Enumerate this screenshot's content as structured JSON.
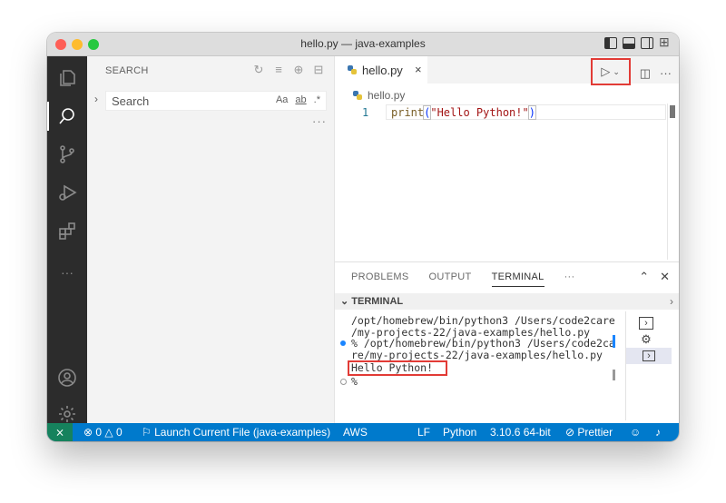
{
  "window": {
    "title": "hello.py — java-examples"
  },
  "activity_bar": {
    "items": [
      "explorer-icon",
      "search-icon",
      "source-control-icon",
      "run-debug-icon",
      "extensions-icon",
      "more-icon",
      "account-icon",
      "settings-icon"
    ],
    "more_label": "···"
  },
  "sidebar": {
    "header": "SEARCH",
    "search_placeholder": "Search",
    "option_case": "Aa",
    "option_word": "ab",
    "option_regex": ".*",
    "more": "···"
  },
  "editor": {
    "tab_label": "hello.py",
    "tab_close": "×",
    "more_actions": "···",
    "breadcrumb": "hello.py",
    "line_number": "1",
    "code_fn": "print",
    "code_open": "(",
    "code_str": "\"Hello Python!\"",
    "code_close": ")"
  },
  "panel": {
    "tabs": [
      "PROBLEMS",
      "OUTPUT",
      "TERMINAL",
      "···"
    ],
    "active_tab": "TERMINAL",
    "terminal_header": "TERMINAL",
    "terminal_lines": [
      "/opt/homebrew/bin/python3 /Users/code2care",
      "/my-projects-22/java-examples/hello.py",
      "% /opt/homebrew/bin/python3 /Users/code2ca",
      "re/my-projects-22/java-examples/hello.py"
    ],
    "output_line": "Hello Python!",
    "prompt": "%"
  },
  "status_bar": {
    "errors": "0",
    "warnings": "0",
    "launch": "Launch Current File (java-examples)",
    "aws": "AWS",
    "eol": "LF",
    "language": "Python",
    "interpreter": "3.10.6 64-bit",
    "prettier": "Prettier"
  },
  "colors": {
    "activity_bar": "#2c2c2c",
    "status_bar": "#007acc",
    "highlight_box": "#e23b36"
  }
}
